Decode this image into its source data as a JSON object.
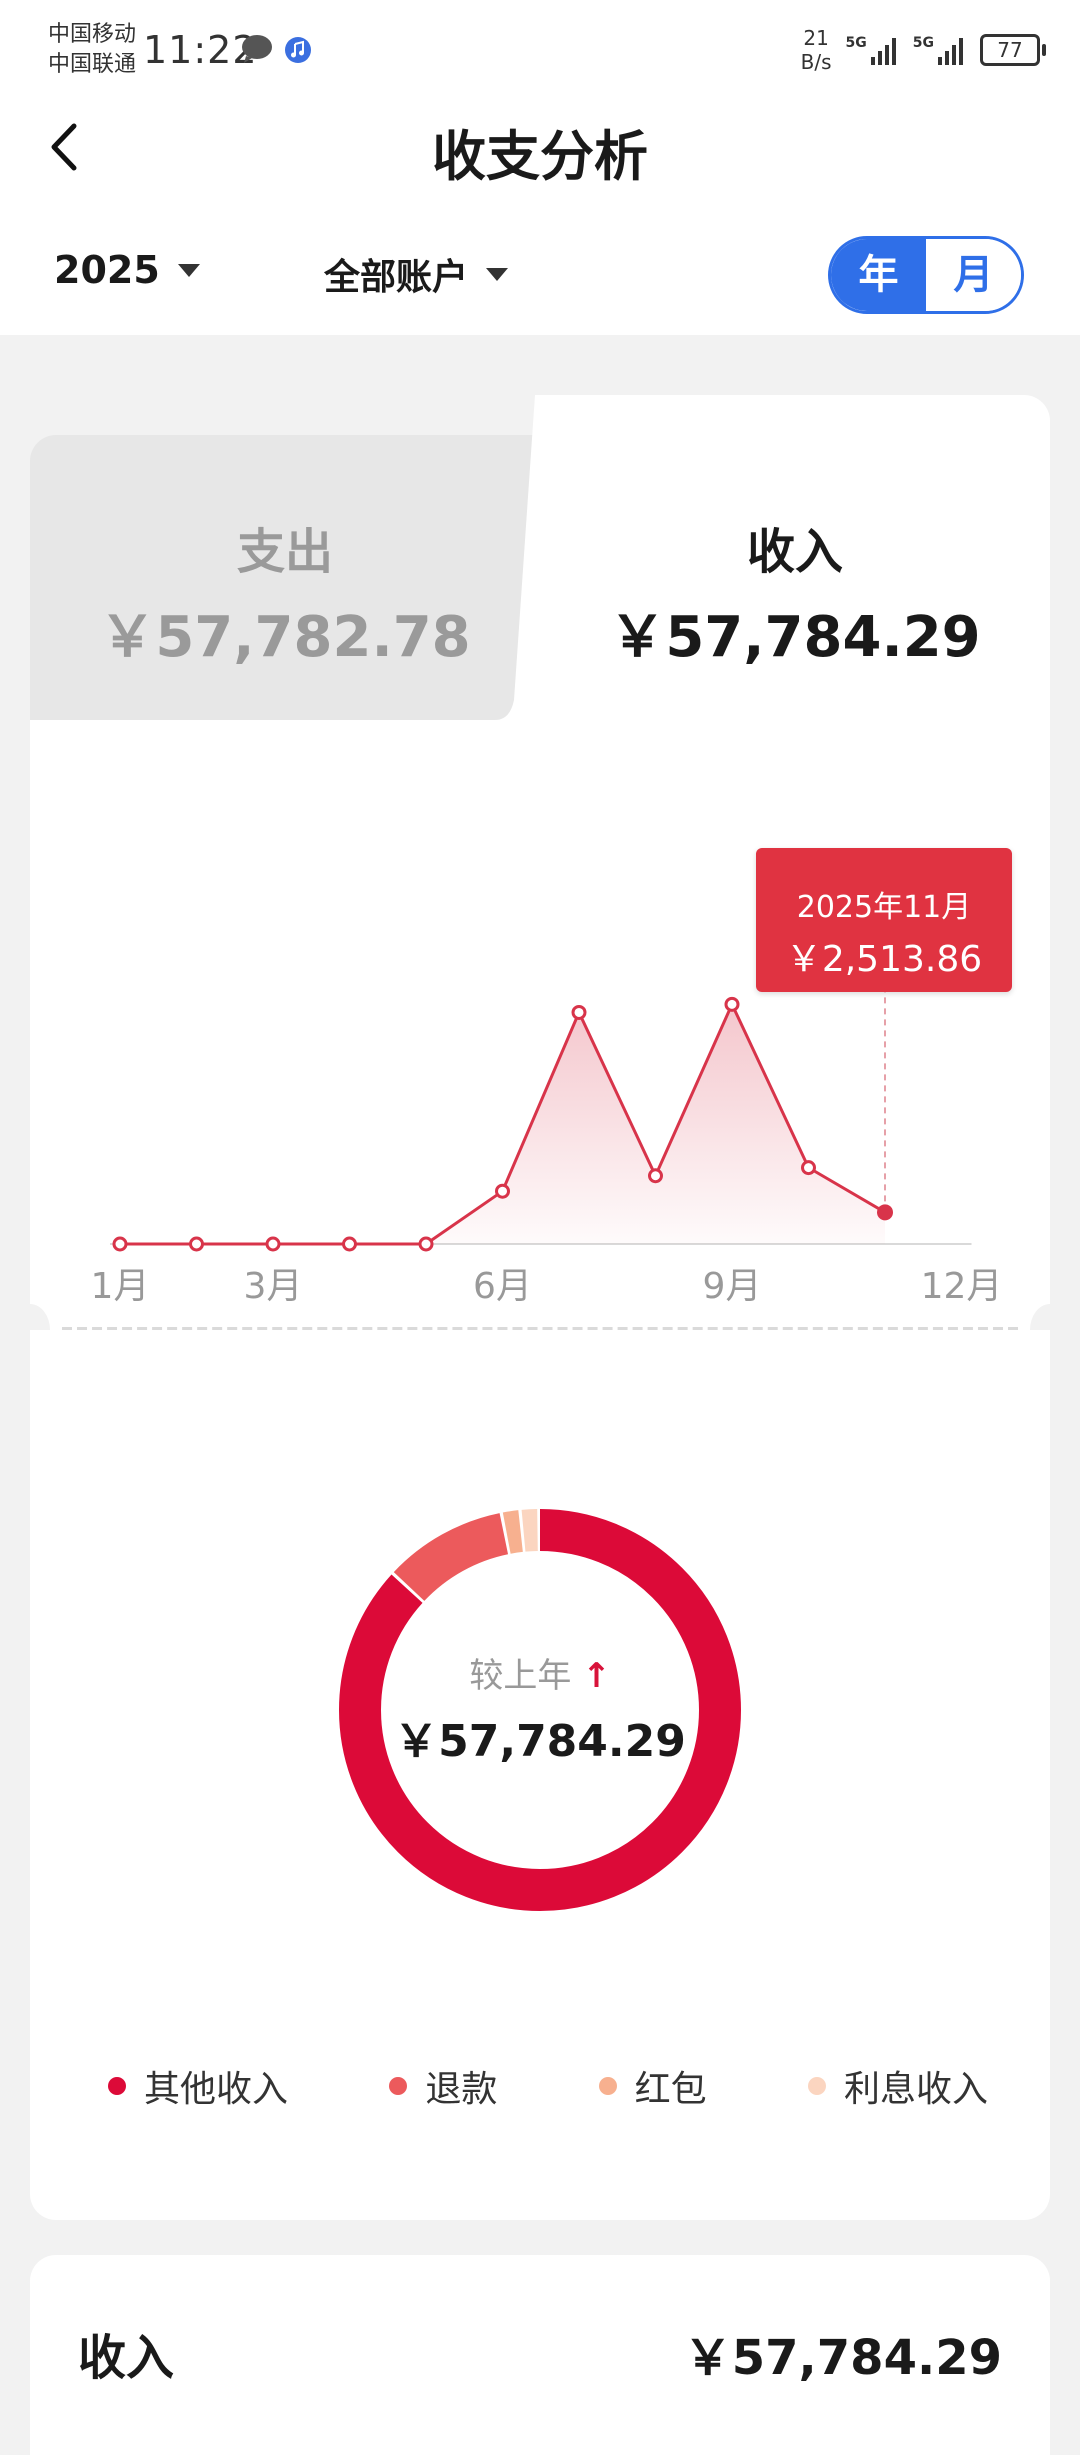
{
  "status_bar": {
    "carrier_1": "中国移动",
    "carrier_2": "中国联通",
    "time": "11:22",
    "net_speed_value": "21",
    "net_speed_unit": "B/s",
    "signal_1": "5G",
    "signal_2": "5G",
    "battery": "77"
  },
  "header": {
    "title": "收支分析",
    "year": "2025",
    "account": "全部账户",
    "toggle_year": "年",
    "toggle_month": "月"
  },
  "summary": {
    "expense_label": "支出",
    "expense_value": "￥57,782.78",
    "income_label": "收入",
    "income_value": "￥57,784.29"
  },
  "chart_data": {
    "type": "line",
    "x": [
      "1月",
      "2月",
      "3月",
      "4月",
      "5月",
      "6月",
      "7月",
      "8月",
      "9月",
      "10月",
      "11月"
    ],
    "x_tick_labels": [
      "1月",
      "3月",
      "6月",
      "9月",
      "12月"
    ],
    "values": [
      0,
      0,
      0,
      0,
      0,
      1300,
      5700,
      1680,
      5900,
      1880,
      780
    ],
    "selected_index": 10,
    "tooltip": {
      "date": "2025年11月",
      "value": "￥2,513.86"
    },
    "color": "#d8344a"
  },
  "donut": {
    "compare_label": "较上年",
    "compare_arrow": "↑",
    "center_value": "￥57,784.29",
    "segments": [
      {
        "name": "其他收入",
        "share": 0.87,
        "color": "#dc0a38"
      },
      {
        "name": "退款",
        "share": 0.1,
        "color": "#ec5a5c"
      },
      {
        "name": "红包",
        "share": 0.015,
        "color": "#f7b08f"
      },
      {
        "name": "利息收入",
        "share": 0.015,
        "color": "#fbd5c0"
      }
    ]
  },
  "legend": [
    {
      "label": "其他收入",
      "color": "#dc0a38"
    },
    {
      "label": "退款",
      "color": "#ec5a5c"
    },
    {
      "label": "红包",
      "color": "#f7b08f"
    },
    {
      "label": "利息收入",
      "color": "#fbd5c0"
    }
  ],
  "bottom": {
    "label": "收入",
    "value": "￥57,784.29"
  }
}
